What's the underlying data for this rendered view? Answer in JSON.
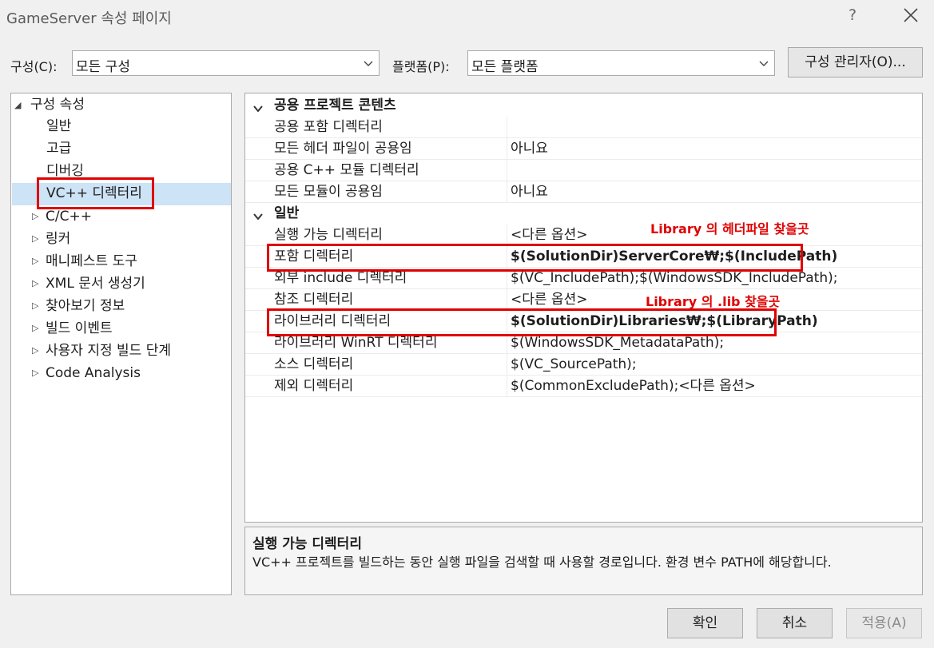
{
  "window": {
    "title": "GameServer 속성 페이지",
    "help_label": "?"
  },
  "toolbar": {
    "config_label": "구성(C):",
    "config_value": "모든 구성",
    "platform_label": "플랫폼(P):",
    "platform_value": "모든 플랫폼",
    "config_manager_label": "구성 관리자(O)..."
  },
  "tree": {
    "root": "구성 속성",
    "root_glyph": "◢",
    "items": [
      "일반",
      "고급",
      "디버깅",
      "VC++ 디렉터리"
    ],
    "collapsed": [
      "C/C++",
      "링커",
      "매니페스트 도구",
      "XML 문서 생성기",
      "찾아보기 정보",
      "빌드 이벤트",
      "사용자 지정 빌드 단계",
      "Code Analysis"
    ],
    "collapsed_glyph": "▷",
    "selected": "VC++ 디렉터리"
  },
  "grid": {
    "categories": [
      {
        "title": "공용 프로젝트 콘텐츠",
        "rows": [
          {
            "name": "공용 포함 디렉터리",
            "value": ""
          },
          {
            "name": "모든 헤더 파일이 공용임",
            "value": "아니요"
          },
          {
            "name": "공용 C++ 모듈 디렉터리",
            "value": ""
          },
          {
            "name": "모든 모듈이 공용임",
            "value": "아니요"
          }
        ]
      },
      {
        "title": "일반",
        "rows": [
          {
            "name": "실행 가능 디렉터리",
            "value": "<다른 옵션>"
          },
          {
            "name": "포함 디렉터리",
            "value": "$(SolutionDir)ServerCore₩;$(IncludePath)"
          },
          {
            "name": "외부 include 디렉터리",
            "value": "$(VC_IncludePath);$(WindowsSDK_IncludePath);"
          },
          {
            "name": "참조 디렉터리",
            "value": "<다른 옵션>"
          },
          {
            "name": "라이브러리 디렉터리",
            "value": "$(SolutionDir)Libraries₩;$(LibraryPath)"
          },
          {
            "name": "라이브러리 WinRT 디렉터리",
            "value": "$(WindowsSDK_MetadataPath);"
          },
          {
            "name": "소스 디렉터리",
            "value": "$(VC_SourcePath);"
          },
          {
            "name": "제외 디렉터리",
            "value": "$(CommonExcludePath);<다른 옵션>"
          }
        ]
      }
    ]
  },
  "annotations": {
    "include": "Library 의 헤더파일 찾을곳",
    "lib": "Library 의 .lib 찾을곳",
    "color": "#e00000"
  },
  "description": {
    "title": "실행 가능 디렉터리",
    "body": "VC++ 프로젝트를 빌드하는 동안 실행 파일을 검색할 때 사용할 경로입니다.  환경 변수 PATH에 해당합니다."
  },
  "buttons": {
    "ok": "확인",
    "cancel": "취소",
    "apply": "적용(A)"
  }
}
